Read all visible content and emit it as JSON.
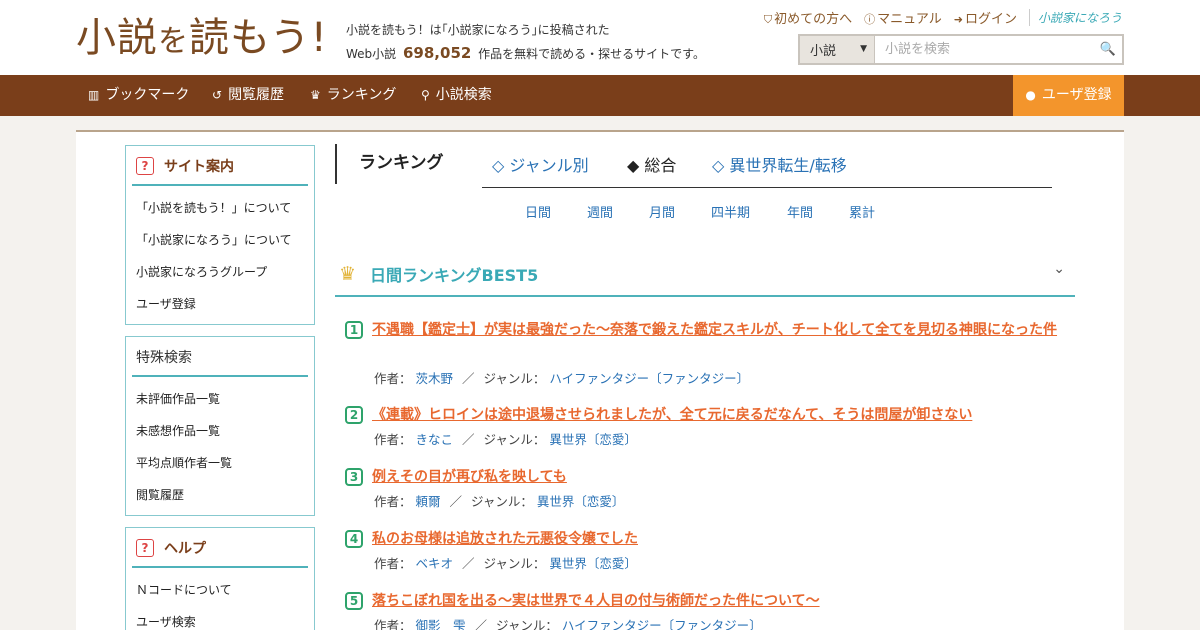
{
  "header": {
    "logo_main": "小説",
    "logo_small": "を",
    "logo_tail": "読もう!",
    "tagline_line1": "小説を読もう！は｢小説家になろう｣に投稿された",
    "tagline_prefix": "Web小説",
    "work_count": "698,052",
    "tagline_suffix": "作品を無料で読める・探せるサイトです。",
    "links": {
      "first_time": "初めての方へ",
      "manual": "マニュアル",
      "login": "ログイン",
      "brand": "小説家になろう"
    },
    "search": {
      "category": "小説",
      "placeholder": "小説を検索"
    }
  },
  "nav": {
    "bookmark": "ブックマーク",
    "history": "閲覧履歴",
    "ranking": "ランキング",
    "search": "小説検索",
    "register": "ユーザ登録"
  },
  "sidebar": {
    "site_guide": {
      "title": "サイト案内",
      "items": [
        "「小説を読もう！」について",
        "「小説家になろう」について",
        "小説家になろうグループ",
        "ユーザ登録"
      ]
    },
    "special_search": {
      "title": "特殊検索",
      "items": [
        "未評価作品一覧",
        "未感想作品一覧",
        "平均点順作者一覧",
        "閲覧履歴"
      ]
    },
    "help": {
      "title": "ヘルプ",
      "items": [
        "Ｎコードについて",
        "ユーザ検索"
      ]
    }
  },
  "ranking": {
    "title": "ランキング",
    "tabs": [
      "◇ ジャンル別",
      "◆ 総合",
      "◇ 異世界転生/転移"
    ],
    "periods": [
      "日間",
      "週間",
      "月間",
      "四半期",
      "年間",
      "累計"
    ],
    "section_title": "日間ランキングBEST5",
    "author_label": "作者：",
    "genre_label": "ジャンル：",
    "entries": [
      {
        "rank": "1",
        "title": "不遇職【鑑定士】が実は最強だった〜奈落で鍛えた鑑定スキルが、チート化して全てを見切る神眼になった件",
        "author": "茨木野",
        "genre": "ハイファンタジー〔ファンタジー〕"
      },
      {
        "rank": "2",
        "title": "《連載》ヒロインは途中退場させられましたが、全て元に戻るだなんて、そうは問屋が卸さない",
        "author": "きなこ",
        "genre": "異世界〔恋愛〕"
      },
      {
        "rank": "3",
        "title": "例えその目が再び私を映しても",
        "author": "頼爾",
        "genre": "異世界〔恋愛〕"
      },
      {
        "rank": "4",
        "title": "私のお母様は追放された元悪役令嬢でした",
        "author": "ベキオ",
        "genre": "異世界〔恋愛〕"
      },
      {
        "rank": "5",
        "title": "落ちこぼれ国を出る〜実は世界で４人目の付与術師だった件について〜",
        "author": "御影　雫",
        "genre": "ハイファンタジー〔ファンタジー〕"
      }
    ]
  },
  "colors": {
    "brand_brown": "#7a3e1a",
    "accent_orange": "#f3952c",
    "teal": "#4fb2ba",
    "link_blue": "#2a72b5",
    "title_orange": "#e8682f",
    "rank_green": "#2ea36b"
  },
  "icons": [
    "bookmark-icon",
    "history-icon",
    "crown-icon",
    "search-icon",
    "user-icon",
    "question-icon",
    "chevron-down-icon"
  ]
}
